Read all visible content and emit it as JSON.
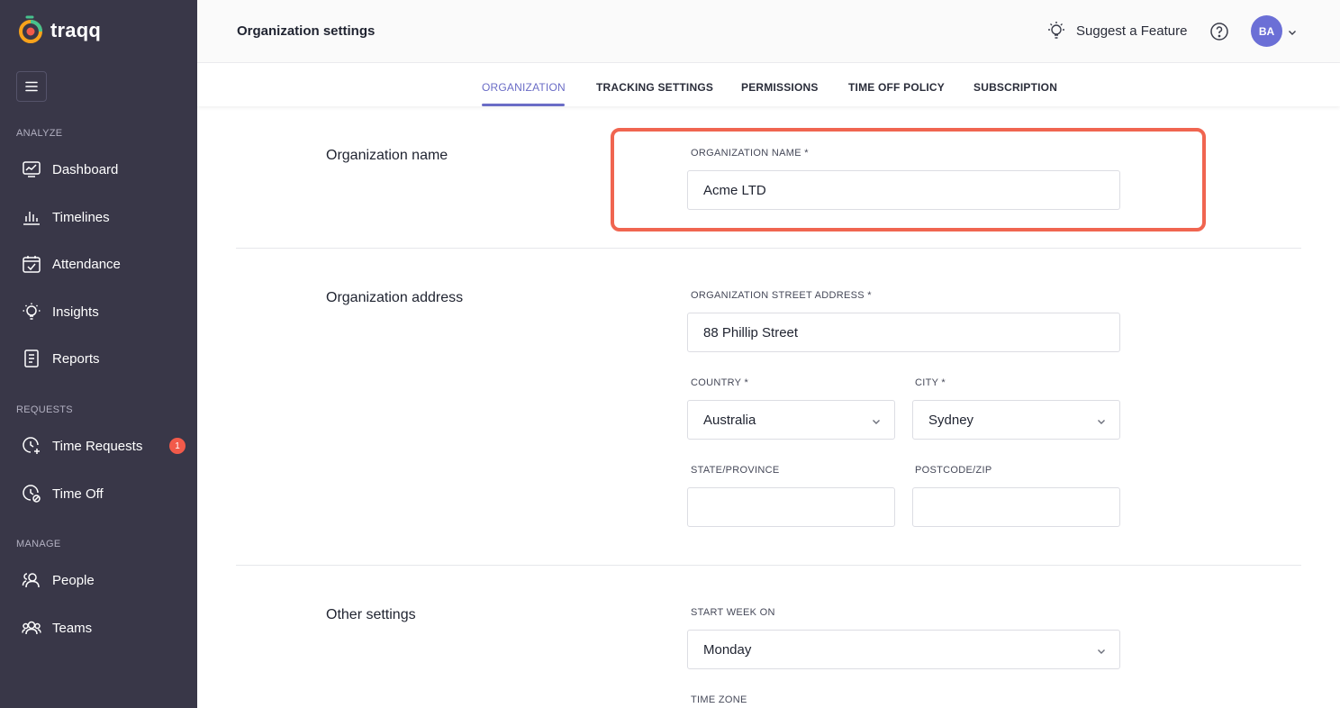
{
  "app": {
    "name": "traqq"
  },
  "sidebar": {
    "sections": {
      "analyze": "ANALYZE",
      "requests": "REQUESTS",
      "manage": "MANAGE"
    },
    "items": {
      "dashboard": "Dashboard",
      "timelines": "Timelines",
      "attendance": "Attendance",
      "insights": "Insights",
      "reports": "Reports",
      "time_requests": "Time Requests",
      "time_requests_badge": "1",
      "time_off": "Time Off",
      "people": "People",
      "teams": "Teams"
    }
  },
  "header": {
    "title": "Organization settings",
    "suggest": "Suggest a Feature",
    "avatar_initials": "BA"
  },
  "tabs": {
    "organization": "ORGANIZATION",
    "tracking": "TRACKING SETTINGS",
    "permissions": "PERMISSIONS",
    "time_off_policy": "TIME OFF POLICY",
    "subscription": "SUBSCRIPTION"
  },
  "org_name": {
    "section_title": "Organization name",
    "label": "ORGANIZATION NAME *",
    "value": "Acme LTD"
  },
  "org_address": {
    "section_title": "Organization address",
    "street_label": "ORGANIZATION STREET ADDRESS *",
    "street_value": "88 Phillip Street",
    "country_label": "COUNTRY *",
    "country_value": "Australia",
    "city_label": "CITY *",
    "city_value": "Sydney",
    "state_label": "STATE/PROVINCE",
    "state_value": "",
    "postcode_label": "POSTCODE/ZIP",
    "postcode_value": ""
  },
  "other": {
    "section_title": "Other settings",
    "start_week_label": "START WEEK ON",
    "start_week_value": "Monday",
    "timezone_label": "TIME ZONE"
  },
  "colors": {
    "sidebar_bg": "#393748",
    "accent": "#6a6cc6",
    "highlight": "#f06550",
    "badge": "#f25a4a"
  }
}
